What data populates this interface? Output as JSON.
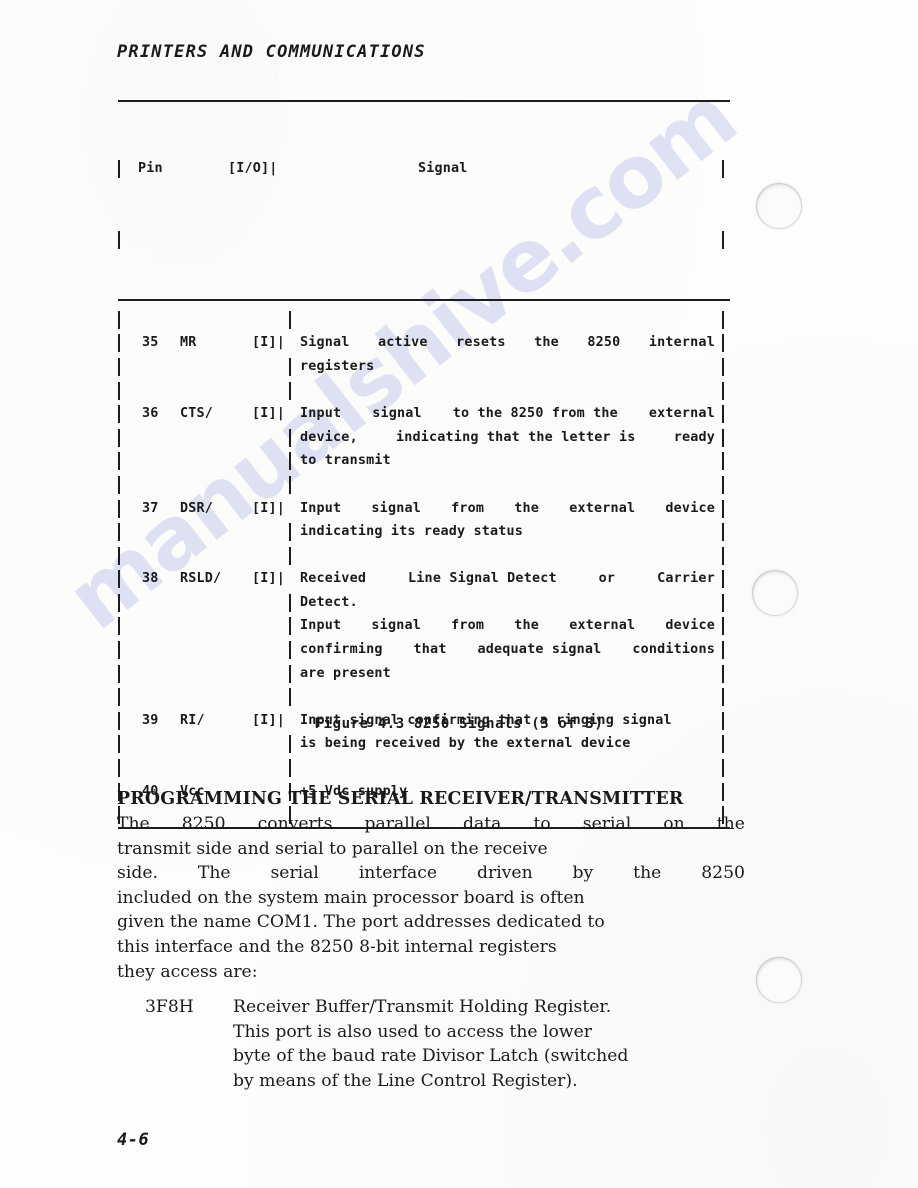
{
  "running_head": "PRINTERS AND COMMUNICATIONS",
  "folio": "4-6",
  "watermark": "manualshive.com",
  "figure": {
    "caption": "Figure 4.3  8250 Signals (3 of 3)",
    "headers": {
      "pin": "Pin",
      "io": "[I/O]|",
      "signal": "Signal"
    },
    "rows": [
      {
        "pin": "35",
        "name": "MR",
        "io": "[I]|",
        "lines": [
          {
            "words": [
              "Signal",
              "active",
              "resets",
              "the",
              "8250",
              "internal"
            ],
            "justify": true
          },
          {
            "words": [
              "registers"
            ],
            "justify": false
          }
        ]
      },
      {
        "pin": "36",
        "name": "CTS/",
        "io": "[I]|",
        "lines": [
          {
            "words": [
              "Input",
              "signal",
              "to the 8250 from the",
              "external"
            ],
            "justify": true
          },
          {
            "words": [
              "device,",
              "indicating that the letter is",
              "ready"
            ],
            "justify": true
          },
          {
            "words": [
              "to transmit"
            ],
            "justify": false
          }
        ]
      },
      {
        "pin": "37",
        "name": "DSR/",
        "io": "[I]|",
        "lines": [
          {
            "words": [
              "Input",
              "signal",
              "from",
              "the",
              "external",
              "device"
            ],
            "justify": true
          },
          {
            "words": [
              "indicating its ready status"
            ],
            "justify": false
          }
        ]
      },
      {
        "pin": "38",
        "name": "RSLD/",
        "io": "[I]|",
        "lines": [
          {
            "words": [
              "Received",
              "Line Signal Detect",
              "or",
              "Carrier"
            ],
            "justify": true
          },
          {
            "words": [
              "Detect."
            ],
            "justify": false
          },
          {
            "words": [
              "Input",
              "signal",
              "from",
              "the",
              "external",
              "device"
            ],
            "justify": true
          },
          {
            "words": [
              "confirming",
              "that",
              "adequate signal",
              "conditions"
            ],
            "justify": true
          },
          {
            "words": [
              "are present"
            ],
            "justify": false
          }
        ]
      },
      {
        "pin": "39",
        "name": "RI/",
        "io": "[I]|",
        "lines": [
          {
            "words": [
              "Input signal confirming that a ringing signal"
            ],
            "justify": false
          },
          {
            "words": [
              "is being received by the external device"
            ],
            "justify": false
          }
        ]
      },
      {
        "pin": "40",
        "name": "Vcc",
        "io": "",
        "lines": [
          {
            "words": [
              "+5 Vdc supply"
            ],
            "justify": false
          }
        ]
      }
    ]
  },
  "section": {
    "heading": "PROGRAMMING THE SERIAL RECEIVER/TRANSMITTER",
    "paragraph_lines": [
      {
        "words": [
          "The",
          "8250",
          "converts",
          "parallel",
          "data",
          "to",
          "serial",
          "on",
          "the"
        ],
        "justify": true
      },
      {
        "words": [
          "transmit side and serial to parallel on the receive"
        ],
        "justify": false
      },
      {
        "words": [
          "side.",
          "The",
          "serial",
          "interface",
          "driven",
          "by",
          "the",
          "8250"
        ],
        "justify": true
      },
      {
        "words": [
          "included on the system main processor board is often"
        ],
        "justify": false
      },
      {
        "words": [
          "given the name COM1. The port addresses dedicated to"
        ],
        "justify": false
      },
      {
        "words": [
          "this interface and the 8250 8-bit internal registers"
        ],
        "justify": false
      },
      {
        "words": [
          "they access are:"
        ],
        "justify": false
      }
    ]
  },
  "register_entry": {
    "address": "3F8H",
    "lines": [
      "Receiver Buffer/Transmit Holding Register.",
      "This port is also used to access the lower",
      "byte of the baud rate Divisor Latch (switched",
      "by means of the Line Control Register)."
    ]
  }
}
